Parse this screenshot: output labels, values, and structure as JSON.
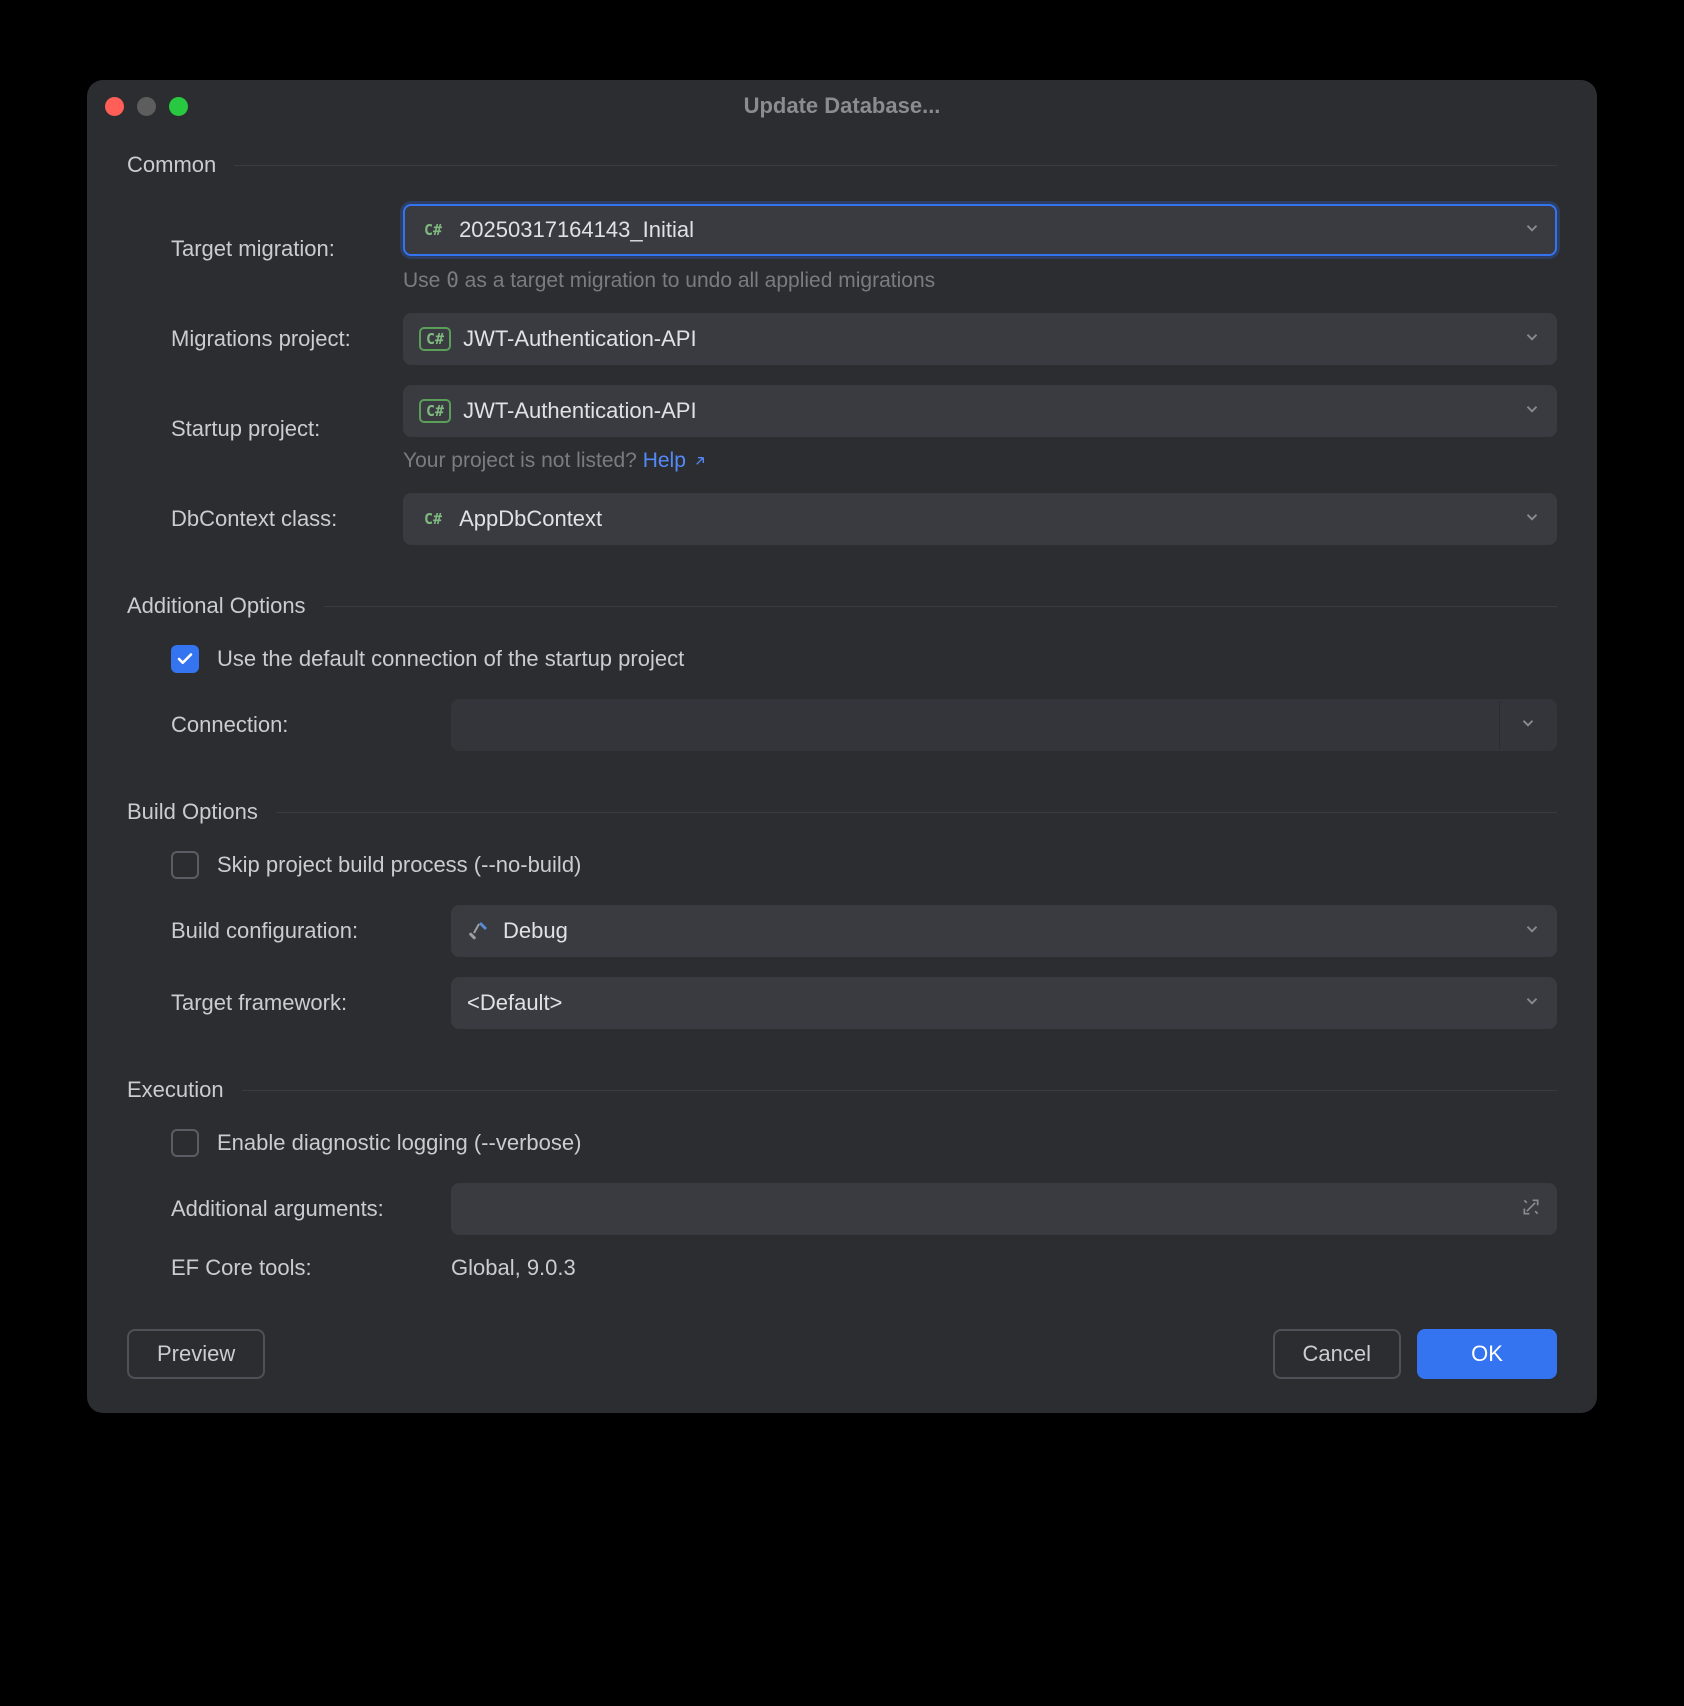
{
  "title": "Update Database...",
  "sections": {
    "common": {
      "title": "Common",
      "target_migration_label": "Target migration:",
      "target_migration_value": "20250317164143_Initial",
      "target_migration_hint_prefix": "Use ",
      "target_migration_hint_code": "0",
      "target_migration_hint_suffix": " as a target migration to undo all applied migrations",
      "migrations_project_label": "Migrations project:",
      "migrations_project_value": "JWT-Authentication-API",
      "startup_project_label": "Startup project:",
      "startup_project_value": "JWT-Authentication-API",
      "startup_hint_prefix": "Your project is not listed? ",
      "startup_hint_link": "Help",
      "dbcontext_label": "DbContext class:",
      "dbcontext_value": "AppDbContext"
    },
    "additional": {
      "title": "Additional Options",
      "use_default_connection_label": "Use the default connection of the startup project",
      "use_default_connection_checked": true,
      "connection_label": "Connection:",
      "connection_value": ""
    },
    "build": {
      "title": "Build Options",
      "skip_build_label": "Skip project build process (--no-build)",
      "skip_build_checked": false,
      "build_config_label": "Build configuration:",
      "build_config_value": "Debug",
      "target_framework_label": "Target framework:",
      "target_framework_value": "<Default>"
    },
    "execution": {
      "title": "Execution",
      "diagnostic_logging_label": "Enable diagnostic logging (--verbose)",
      "diagnostic_logging_checked": false,
      "additional_args_label": "Additional arguments:",
      "additional_args_value": "",
      "ef_tools_label": "EF Core tools:",
      "ef_tools_value": "Global, 9.0.3"
    }
  },
  "footer": {
    "preview": "Preview",
    "cancel": "Cancel",
    "ok": "OK"
  },
  "badges": {
    "csharp": "C#"
  }
}
